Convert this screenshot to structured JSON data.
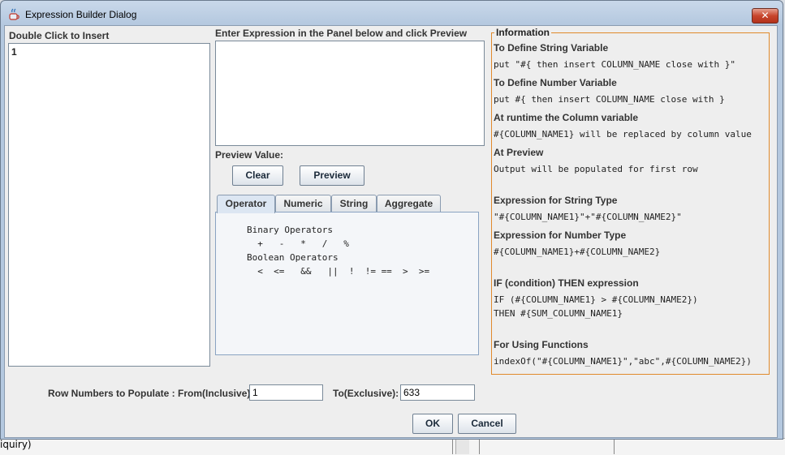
{
  "window": {
    "title": "Expression Builder Dialog",
    "close_label": "✕"
  },
  "left": {
    "label": "Double Click to Insert",
    "items": [
      "1"
    ]
  },
  "expression": {
    "label": "Enter Expression in the Panel below and click Preview",
    "value": ""
  },
  "preview": {
    "label": "Preview Value:",
    "clear": "Clear",
    "preview": "Preview"
  },
  "tabs": [
    "Operator",
    "Numeric",
    "String",
    "Aggregate"
  ],
  "operator_panel": {
    "lines": [
      "Binary Operators",
      "  +   -   *   /   %",
      "Boolean Operators",
      "  <  <=   &&   ||  !  != ==  >  >="
    ]
  },
  "info": {
    "title": "Information",
    "h1": "To Define String Variable",
    "c1": "put \"#{ then insert COLUMN_NAME close with }\"",
    "h2": "To Define Number Variable",
    "c2": "put #{ then insert COLUMN_NAME close with }",
    "h3": "At runtime the Column variable",
    "c3": "#{COLUMN_NAME1} will be replaced by column value",
    "h4": "At Preview",
    "c4": "Output will be populated for first row",
    "h5": "Expression for String Type",
    "c5": "\"#{COLUMN_NAME1}\"+\"#{COLUMN_NAME2}\"",
    "h6": "Expression for Number Type",
    "c6": "#{COLUMN_NAME1}+#{COLUMN_NAME2}",
    "h7": "IF (condition) THEN expression",
    "c7a": "IF (#{COLUMN_NAME1} > #{COLUMN_NAME2})",
    "c7b": "THEN #{SUM_COLUMN_NAME1}",
    "h8": "For Using Functions",
    "c8": "indexOf(\"#{COLUMN_NAME1}\",\"abc\",#{COLUMN_NAME2})"
  },
  "rows": {
    "from_label": "Row Numbers to Populate : From(Inclusive)",
    "from_value": "1",
    "to_label": "To(Exclusive):",
    "to_value": "633"
  },
  "buttons": {
    "ok": "OK",
    "cancel": "Cancel"
  },
  "background": {
    "text": "iquiry)"
  }
}
